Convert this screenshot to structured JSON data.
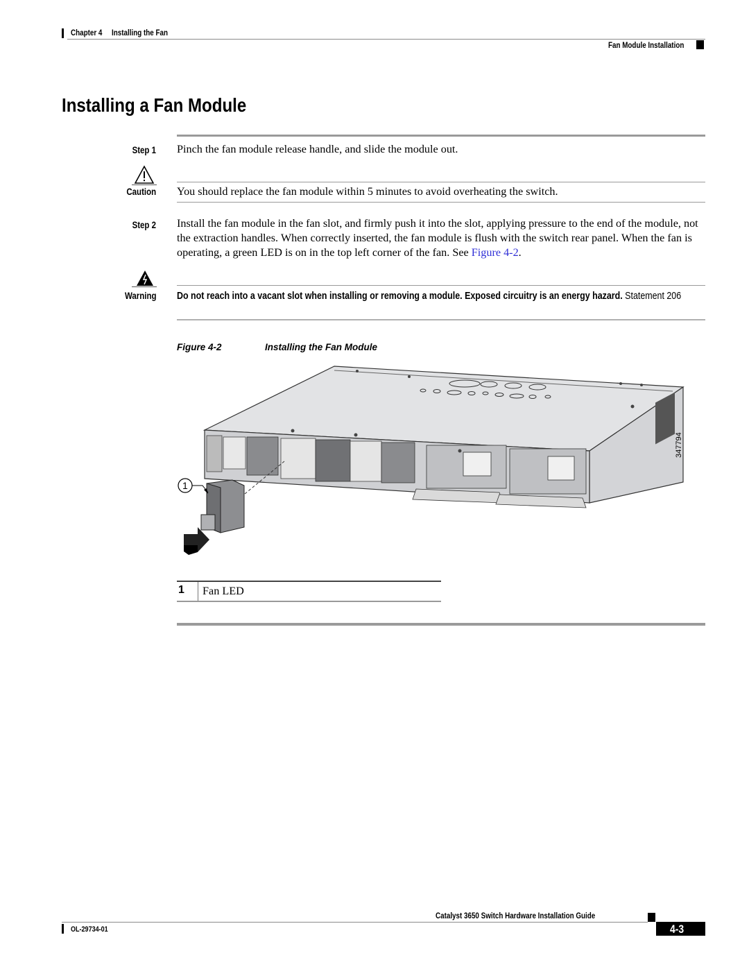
{
  "header": {
    "chapter": "Chapter 4     Installing the Fan",
    "section": "Fan Module Installation"
  },
  "title": "Installing a Fan Module",
  "steps": [
    {
      "label": "Step 1",
      "text": "Pinch the fan module release handle, and slide the module out."
    },
    {
      "label": "Step 2",
      "text_before_link": "Install the fan module in the fan slot, and firmly push it into the slot, applying pressure to the end of the module, not the extraction handles. When correctly inserted, the fan module is flush with the switch rear panel. When the fan is operating, a green LED is on in the top left corner of the fan. See ",
      "link": "Figure 4-2",
      "text_after_link": "."
    }
  ],
  "caution": {
    "icon": "caution-triangle-icon",
    "label": "Caution",
    "text": "You should replace the fan module within 5 minutes to avoid overheating the switch."
  },
  "warning": {
    "icon": "warning-lightning-icon",
    "label": "Warning",
    "bold_text": "Do not reach into a vacant slot when installing or removing a module. Exposed circuitry is an energy hazard.",
    "statement": " Statement 206"
  },
  "figure": {
    "caption_number": "Figure 4-2",
    "caption_title": "Installing the Fan Module",
    "callout": "1",
    "image_id": "347794",
    "description": "Rear view of Catalyst 3650 switch with fan module being inserted into fan slot"
  },
  "legend": [
    {
      "number": "1",
      "label": "Fan LED"
    }
  ],
  "footer": {
    "guide_title": "Catalyst 3650 Switch Hardware Installation Guide",
    "doc_number": "OL-29734-01",
    "page": "4-3"
  }
}
